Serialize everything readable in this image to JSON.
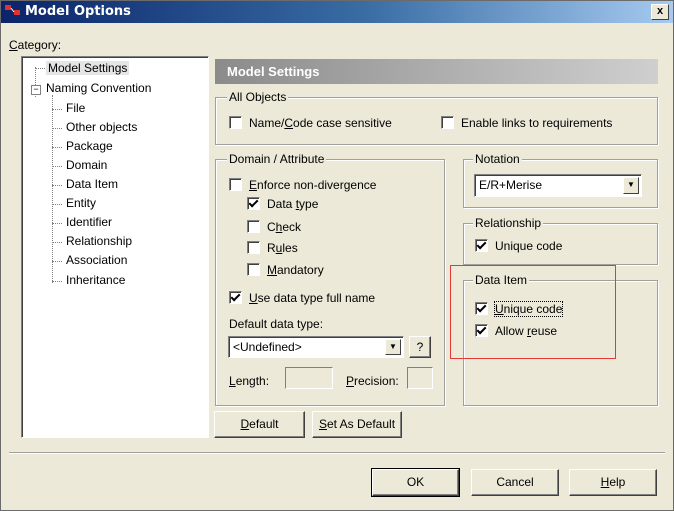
{
  "window": {
    "title": "Model Options",
    "close_glyph": "x"
  },
  "category_label": "Category:",
  "tree": {
    "items": [
      {
        "label": "Model Settings"
      },
      {
        "label": "Naming Convention",
        "expander": "−"
      },
      {
        "label": "File"
      },
      {
        "label": "Other objects"
      },
      {
        "label": "Package"
      },
      {
        "label": "Domain"
      },
      {
        "label": "Data Item"
      },
      {
        "label": "Entity"
      },
      {
        "label": "Identifier"
      },
      {
        "label": "Relationship"
      },
      {
        "label": "Association"
      },
      {
        "label": "Inheritance"
      }
    ]
  },
  "panel_title": "Model Settings",
  "all_objects": {
    "title": "All Objects",
    "name_code_case_sensitive": {
      "label": "Name/Code case sensitive",
      "checked": false
    },
    "enable_links": {
      "label": "Enable links to requirements",
      "checked": false
    }
  },
  "domain_attribute": {
    "title": "Domain / Attribute",
    "enforce": {
      "label": "Enforce non-divergence",
      "checked": false
    },
    "data_type": {
      "label": "Data type",
      "checked": true
    },
    "check": {
      "label": "Check",
      "checked": false
    },
    "rules": {
      "label": "Rules",
      "checked": false
    },
    "mandatory": {
      "label": "Mandatory",
      "checked": false
    },
    "use_full_name": {
      "label": "Use data type full name",
      "checked": true
    },
    "default_type_label": "Default data type:",
    "default_type_value": "<Undefined>",
    "question_button": "?",
    "length_label": "Length:",
    "precision_label": "Precision:"
  },
  "notation": {
    "title": "Notation",
    "value": "E/R+Merise"
  },
  "relationship": {
    "title": "Relationship",
    "unique_code": {
      "label": "Unique code",
      "checked": true
    }
  },
  "data_item": {
    "title": "Data Item",
    "unique_code": {
      "label": "Unique code",
      "checked": true
    },
    "allow_reuse": {
      "label": "Allow reuse",
      "checked": true
    }
  },
  "buttons": {
    "default": "Default",
    "set_as_default": "Set As Default",
    "ok": "OK",
    "cancel": "Cancel",
    "help": "Help"
  },
  "colors": {
    "titlebar_start": "#0a246a",
    "highlight_box": "#e53935",
    "dialog_bg": "#ece9d8"
  }
}
